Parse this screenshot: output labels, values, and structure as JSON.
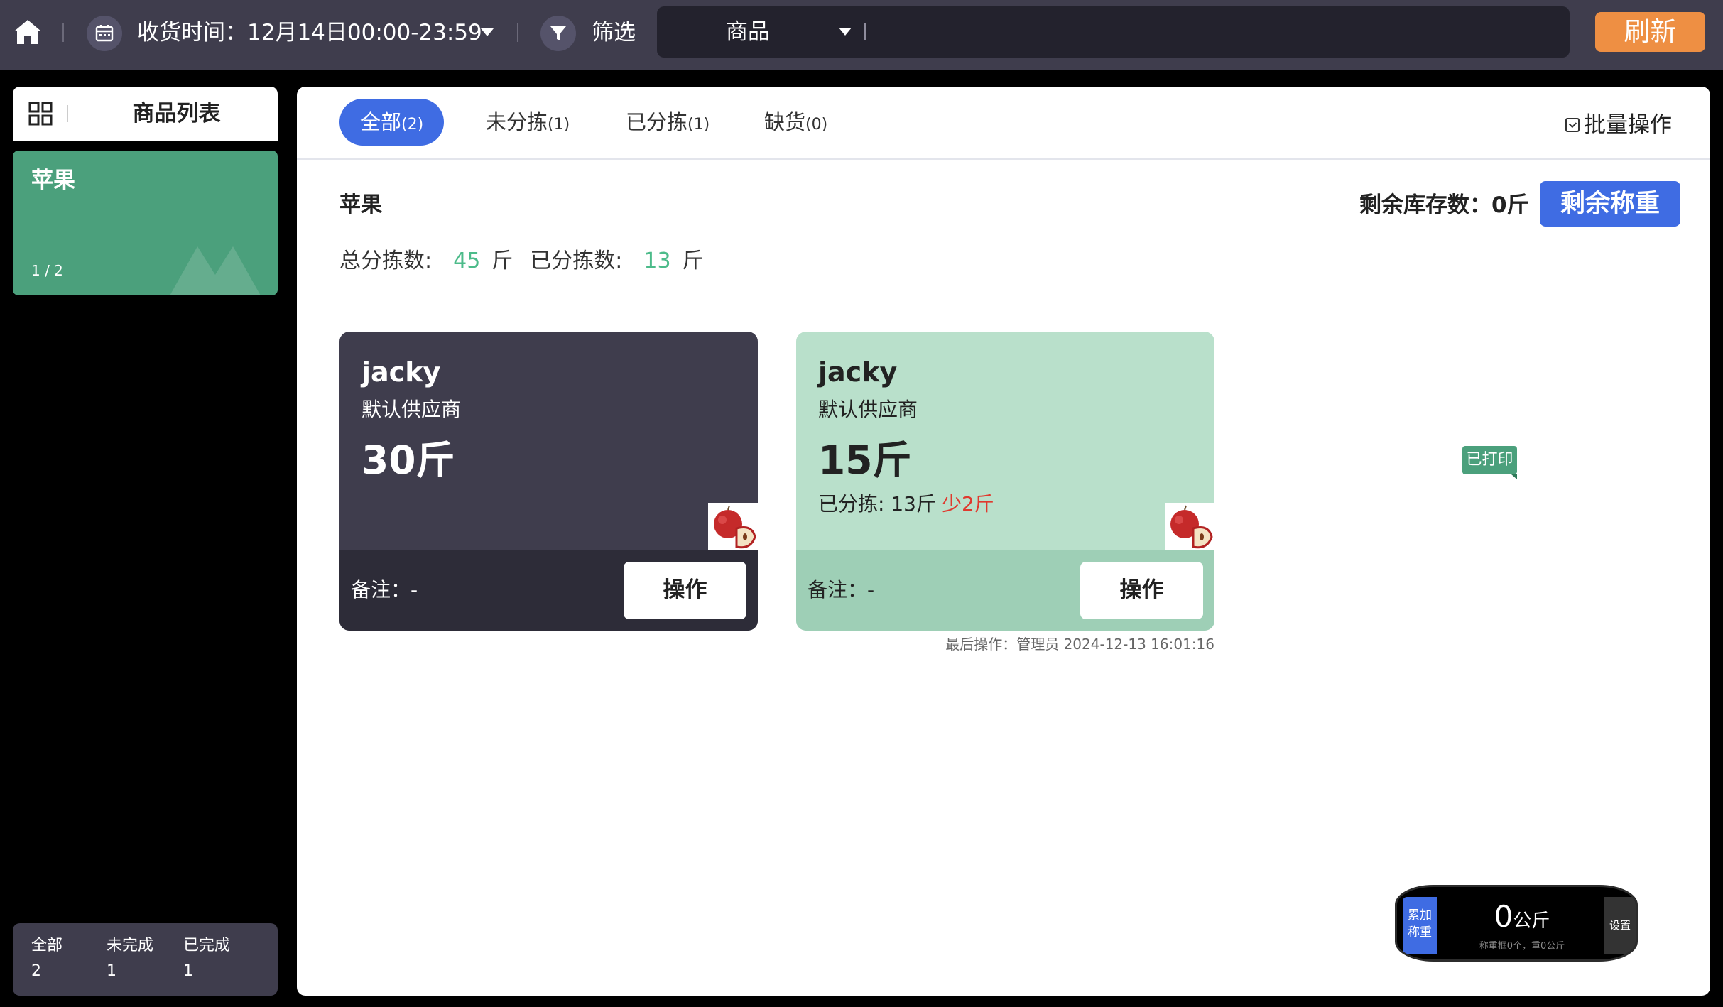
{
  "topbar": {
    "receive_time_label": "收货时间：12月14日00:00-23:59",
    "filter_label": "筛选",
    "product_select": "商品",
    "refresh_label": "刷新"
  },
  "sidebar": {
    "header_title": "商品列表",
    "items": [
      {
        "name": "苹果",
        "progress": "1 / 2"
      }
    ],
    "stats": [
      {
        "label": "全部",
        "value": "2"
      },
      {
        "label": "未完成",
        "value": "1"
      },
      {
        "label": "已完成",
        "value": "1"
      }
    ]
  },
  "tabs": [
    {
      "label": "全部",
      "count": "(2)"
    },
    {
      "label": "未分拣",
      "count": "(1)"
    },
    {
      "label": "已分拣",
      "count": "(1)"
    },
    {
      "label": "缺货",
      "count": "(0)"
    }
  ],
  "main": {
    "batch_label": "批量操作",
    "product_name": "苹果",
    "stock_label": "剩余库存数：0斤",
    "weigh_button": "剩余称重",
    "total_label": "总分拣数:",
    "total_value": "45",
    "total_unit": "斤",
    "picked_label": "已分拣数:",
    "picked_value": "13",
    "picked_unit": "斤"
  },
  "orders": [
    {
      "customer": "jacky",
      "supplier": "默认供应商",
      "quantity": "30斤",
      "note": "备注：-",
      "action": "操作"
    },
    {
      "customer": "jacky",
      "supplier": "默认供应商",
      "quantity": "15斤",
      "picked": "已分拣: 13斤",
      "shortage": "少2斤",
      "badge": "已打印",
      "note": "备注：-",
      "action": "操作",
      "last_operation": "最后操作：管理员 2024-12-13 16:01:16"
    }
  ],
  "scale": {
    "accumulate_label": "累加称重",
    "value": "0",
    "unit": "公斤",
    "sub": "称重框0个，重0公斤",
    "settings_label": "设置"
  },
  "colors": {
    "topbar": "#3f3d4d",
    "accent_blue": "#3f6ce3",
    "accent_orange": "#ee8f43",
    "green": "#4ba07c",
    "light_green": "#b9e0cb",
    "short_red": "#e0392e"
  },
  "icons": [
    "home-icon",
    "calendar-icon",
    "filter-icon",
    "grid-icon",
    "checkbox-icon"
  ]
}
